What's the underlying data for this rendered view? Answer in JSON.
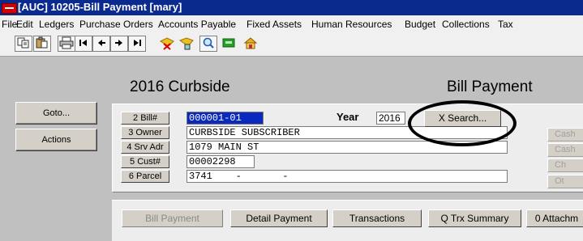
{
  "window": {
    "title": "[AUC] 10205-Bill Payment [mary]"
  },
  "menu": {
    "items": [
      "File",
      "Edit",
      "Ledgers",
      "Purchase Orders",
      "Accounts Payable",
      "Fixed Assets",
      "Human Resources",
      "Budget",
      "Collections",
      "Tax"
    ]
  },
  "toolbar": {
    "icons": [
      "copy-icon",
      "paste-icon",
      "print-icon",
      "first-record-icon",
      "previous-record-icon",
      "next-record-icon",
      "last-record-icon",
      "clear-icon",
      "lookup-icon",
      "search-icon",
      "spreadsheet-icon",
      "home-icon"
    ]
  },
  "nav": {
    "goto": "Goto...",
    "actions": "Actions"
  },
  "module_title": "2016 Curbside",
  "screen_title": "Bill Payment",
  "form": {
    "bill_label": "2 Bill#",
    "bill_value": "000001-01",
    "year_label": "Year",
    "year_value": "2016",
    "search_button": "X Search...",
    "owner_label": "3 Owner",
    "owner_value": "CURBSIDE SUBSCRIBER",
    "srv_adr_label": "4 Srv Adr",
    "srv_adr_value": "1079 MAIN ST",
    "cust_label": "5 Cust#",
    "cust_value": "00002298",
    "parcel_label": "6 Parcel",
    "parcel_value": "3741    -       -"
  },
  "right_buttons": [
    "Cash",
    "Cash",
    "Ch",
    "Ot"
  ],
  "tabs": [
    "Bill Payment",
    "Detail Payment",
    "Transactions",
    "Q Trx Summary",
    "0 Attachm"
  ]
}
